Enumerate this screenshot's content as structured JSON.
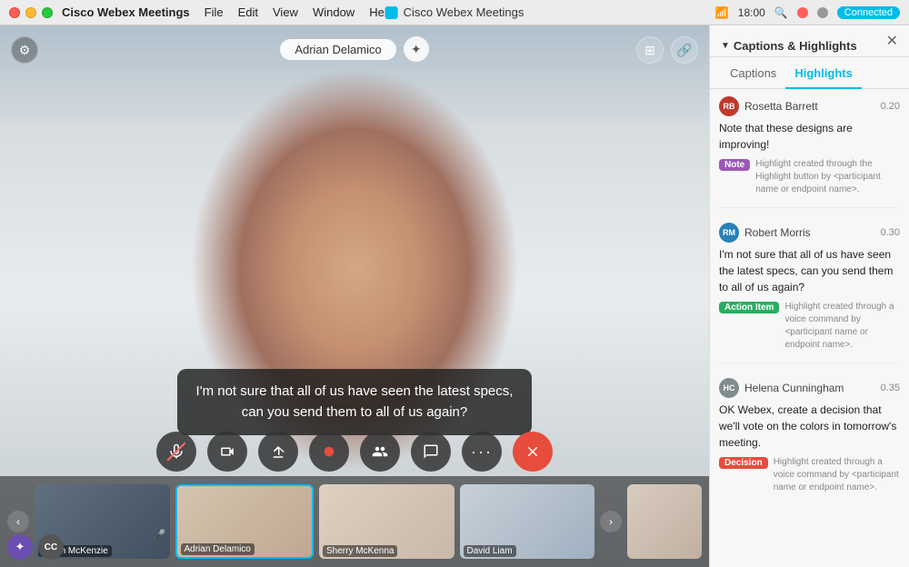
{
  "titlebar": {
    "app_name": "Cisco Webex Meetings",
    "window_title": "Cisco Webex Meetings",
    "menus": [
      "File",
      "Edit",
      "View",
      "Window",
      "Help"
    ],
    "time": "18:00",
    "connected_label": "Connected"
  },
  "video": {
    "participant_name": "Adrian Delamico",
    "caption_text": "I'm not sure that all of us have seen the latest specs, can you send them to all of us again?"
  },
  "controls": {
    "mute": "🎤",
    "video": "📷",
    "share": "⬆",
    "record": "⏺",
    "participants": "👤",
    "chat": "💬",
    "more": "•••",
    "end": "✕"
  },
  "thumbnails": [
    {
      "name": "Julian McKenzie",
      "muted": true
    },
    {
      "name": "Adrian Delamico",
      "active": true,
      "muted": false
    },
    {
      "name": "Sherry McKenna",
      "muted": false
    },
    {
      "name": "David Liam",
      "muted": false
    }
  ],
  "panel": {
    "title": "Captions & Highlights",
    "chevron": "▼",
    "tabs": [
      "Captions",
      "Highlights"
    ],
    "active_tab": "Highlights",
    "highlights": [
      {
        "initials": "RB",
        "name": "Rosetta Barrett",
        "time": "0.20",
        "quote": "Note that these designs are improving!",
        "badge": "Note",
        "badge_type": "note",
        "description": "Highlight created through the Highlight button by <participant name or endpoint name>."
      },
      {
        "initials": "RM",
        "name": "Robert Morris",
        "time": "0.30",
        "quote": "I'm not sure that all of us have seen the latest specs, can you send them to all of us again?",
        "badge": "Action Item",
        "badge_type": "action",
        "description": "Highlight created through a voice command by <participant name or endpoint name>."
      },
      {
        "initials": "HC",
        "name": "Helena Cunningham",
        "time": "0.35",
        "quote": "OK Webex, create a decision that we'll vote on the colors in tomorrow's meeting.",
        "badge": "Decision",
        "badge_type": "decision",
        "description": "Highlight created through a voice command by <participant name or endpoint name>."
      }
    ]
  },
  "bottom_left": {
    "ai_icon": "✦",
    "cc_label": "CC"
  }
}
